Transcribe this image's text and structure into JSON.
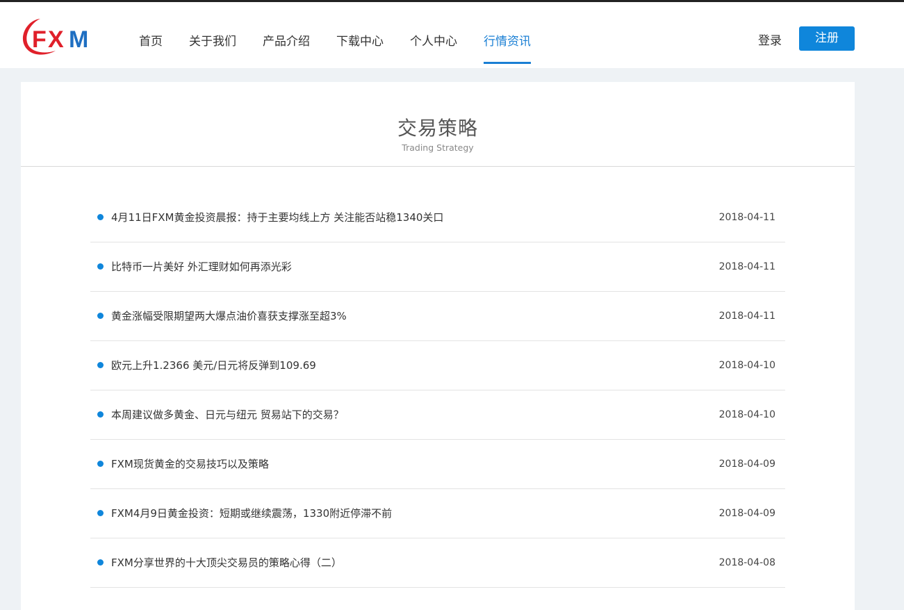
{
  "brand": {
    "logo_text_f": "F",
    "logo_text_x": "X",
    "logo_text_m": "M",
    "colors": {
      "red": "#e0202a",
      "blue": "#1f6fc2",
      "accent": "#0f86db"
    }
  },
  "nav": {
    "items": [
      {
        "label": "首页",
        "active": false
      },
      {
        "label": "关于我们",
        "active": false
      },
      {
        "label": "产品介绍",
        "active": false
      },
      {
        "label": "下载中心",
        "active": false
      },
      {
        "label": "个人中心",
        "active": false
      },
      {
        "label": "行情资讯",
        "active": true
      }
    ]
  },
  "auth": {
    "login_label": "登录",
    "register_label": "注册"
  },
  "section": {
    "title": "交易策略",
    "subtitle": "Trading Strategy"
  },
  "articles": [
    {
      "title": "4月11日FXM黄金投资晨报：持于主要均线上方 关注能否站稳1340关口",
      "date": "2018-04-11"
    },
    {
      "title": "比特币一片美好 外汇理财如何再添光彩",
      "date": "2018-04-11"
    },
    {
      "title": "黄金涨幅受限期望两大爆点油价喜获支撑涨至超3%",
      "date": "2018-04-11"
    },
    {
      "title": "欧元上升1.2366 美元/日元将反弹到109.69",
      "date": "2018-04-10"
    },
    {
      "title": "本周建议做多黄金、日元与纽元 贸易站下的交易？",
      "date": "2018-04-10"
    },
    {
      "title": "FXM现货黄金的交易技巧以及策略",
      "date": "2018-04-09"
    },
    {
      "title": "FXM4月9日黄金投资：短期或继续震荡，1330附近停滞不前",
      "date": "2018-04-09"
    },
    {
      "title": "FXM分享世界的十大顶尖交易员的策略心得（二）",
      "date": "2018-04-08"
    }
  ]
}
